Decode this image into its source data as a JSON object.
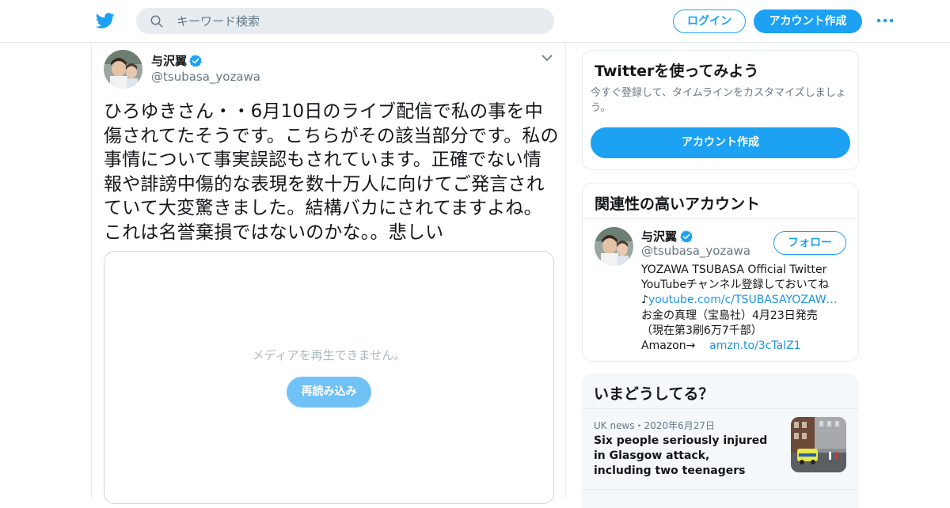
{
  "header": {
    "search_placeholder": "キーワード検索",
    "login_label": "ログイン",
    "signup_label": "アカウント作成",
    "brand_color": "#1da1f2"
  },
  "tweet": {
    "author_name": "与沢翼",
    "author_handle": "@tsubasa_yozawa",
    "text": "ひろゆきさん・・6月10日のライブ配信で私の事を中傷されてたそうです。こちらがその該当部分です。私の事情について事実誤認もされています。正確でない情報や誹謗中傷的な表現を数十万人に向けてご発言されていて大変驚きました。結構バカにされてますよね。これは名誉棄損ではないのかな。。悲しい",
    "media_error": "メディアを再生できません。",
    "media_retry": "再読み込み"
  },
  "signup_card": {
    "title": "Twitterを使ってみよう",
    "description": "今すぐ登録して、タイムラインをカスタマイズしましょう。",
    "button": "アカウント作成"
  },
  "related_card": {
    "title": "関連性の高いアカウント",
    "account": {
      "name": "与沢翼",
      "handle": "@tsubasa_yozawa",
      "follow_label": "フォロー",
      "bio_line1": "YOZAWA TSUBASA Official Twitter",
      "bio_line2": "YouTubeチャンネル登録しておいてね",
      "bio_line3_prefix": "♪",
      "bio_link1": "youtube.com/c/TSUBASAYOZAW…",
      "bio_line4": "お金の真理（宝島社）4月23日発売",
      "bio_line5": "（現在第3刷6万7千部）",
      "bio_line6_prefix": "Amazon→",
      "bio_link2": "amzn.to/3cTalZ1"
    }
  },
  "trends_card": {
    "title": "いまどうしてる？",
    "item": {
      "meta": "UK news・2020年6月27日",
      "headline": "Six people seriously injured in Glasgow attack, including two teenagers"
    }
  }
}
